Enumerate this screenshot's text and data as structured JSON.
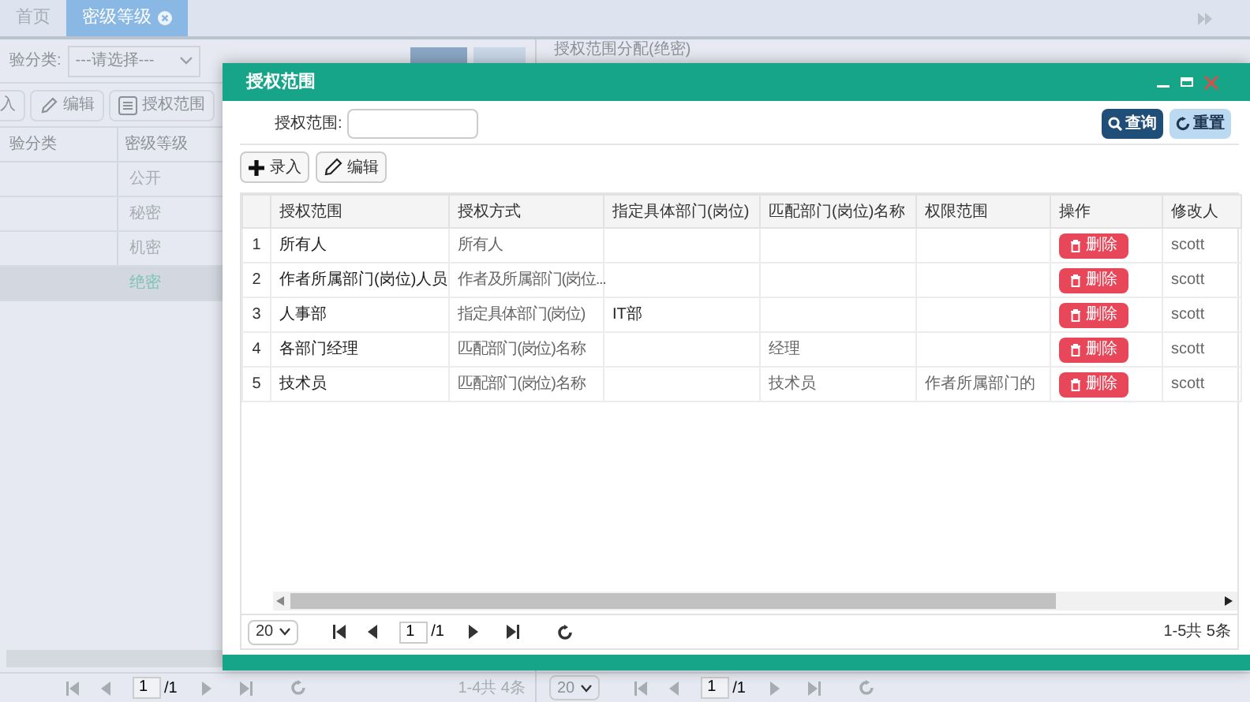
{
  "tabs": [
    {
      "label": "首页",
      "selected": false,
      "closable": false
    },
    {
      "label": "密级等级",
      "selected": true,
      "closable": true
    }
  ],
  "background": {
    "filter": {
      "label": "验分类:",
      "value": "---请选择---"
    },
    "toolbar": [
      {
        "label": "入",
        "kind": "plain"
      },
      {
        "label": "编辑",
        "kind": "edit"
      },
      {
        "label": "授权范围",
        "kind": "list"
      }
    ],
    "columns": [
      "验分类",
      "密级等级"
    ],
    "rows": [
      {
        "level": "公开",
        "selected": false
      },
      {
        "level": "秘密",
        "selected": false
      },
      {
        "level": "机密",
        "selected": false
      },
      {
        "level": "绝密",
        "selected": true
      }
    ],
    "pager": {
      "page": "1",
      "pages": "/1",
      "summary": "1-4共 4条"
    },
    "side_panel": {
      "title": "授权范围分配(绝密)",
      "pager": {
        "page_size": "20",
        "page": "1",
        "pages": "/1"
      }
    }
  },
  "dialog": {
    "title": "授权范围",
    "search": {
      "label": "授权范围:"
    },
    "search_buttons": [
      {
        "label": "查询",
        "kind": "primary"
      },
      {
        "label": "重置",
        "kind": "secondary"
      }
    ],
    "toolbar": [
      {
        "label": "录入",
        "kind": "add"
      },
      {
        "label": "编辑",
        "kind": "edit"
      }
    ],
    "columns": [
      "授权范围",
      "授权方式",
      "指定具体部门(岗位)",
      "匹配部门(岗位)名称",
      "权限范围",
      "操作",
      "修改人"
    ],
    "rows": [
      {
        "no": "1",
        "scope": "所有人",
        "method": "所有人",
        "action": "删除",
        "modifier": "scott"
      },
      {
        "no": "2",
        "scope": "作者所属部门(岗位)人员",
        "method": "作者及所属部门(岗位...",
        "action": "删除",
        "modifier": "scott"
      },
      {
        "no": "3",
        "scope": "人事部",
        "method": "指定具体部门(岗位)",
        "dept": "IT部",
        "action": "删除",
        "modifier": "scott"
      },
      {
        "no": "4",
        "scope": "各部门经理",
        "method": "匹配部门(岗位)名称",
        "match": "经理",
        "action": "删除",
        "modifier": "scott"
      },
      {
        "no": "5",
        "scope": "技术员",
        "method": "匹配部门(岗位)名称",
        "match": "技术员",
        "range": "作者所属部门的",
        "action": "删除",
        "modifier": "scott"
      }
    ],
    "pager": {
      "page_size": "20",
      "page": "1",
      "pages": "/1",
      "summary": "1-5共 5条"
    }
  }
}
